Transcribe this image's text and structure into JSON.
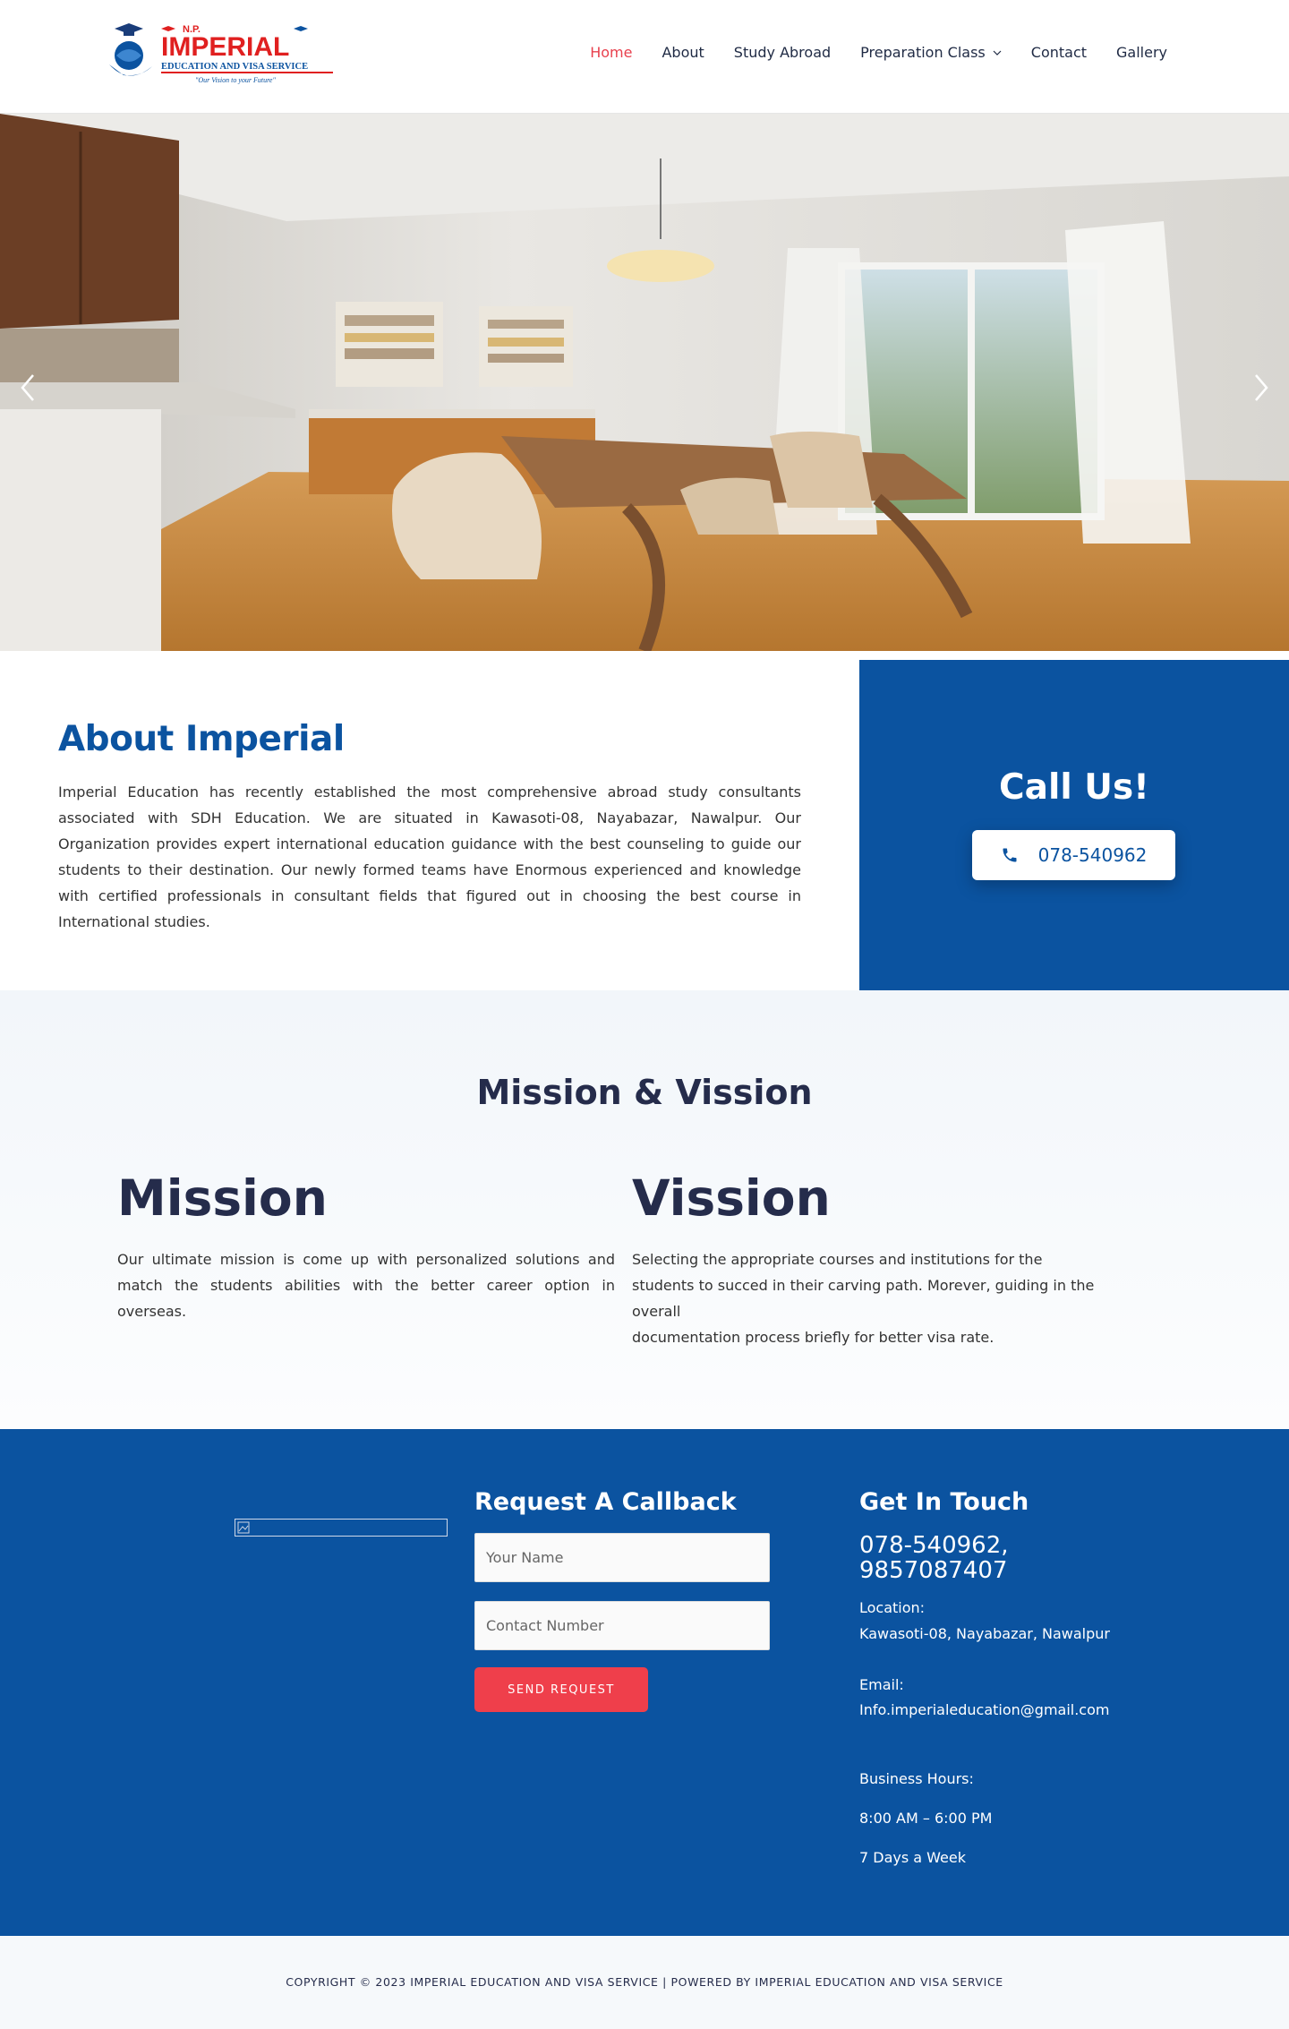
{
  "header": {
    "logo": {
      "top_text": "N.P.",
      "main_text": "IMPERIAL",
      "sub_text": "EDUCATION AND VISA SERVICE",
      "tagline": "\"Our Vision to your Future\""
    },
    "nav": [
      {
        "label": "Home",
        "active": true
      },
      {
        "label": "About"
      },
      {
        "label": "Study Abroad"
      },
      {
        "label": "Preparation Class",
        "has_dropdown": true
      },
      {
        "label": "Contact"
      },
      {
        "label": "Gallery"
      }
    ]
  },
  "hero": {
    "image": "dining-room-photo",
    "prev_icon": "chevron-left-icon",
    "next_icon": "chevron-right-icon"
  },
  "about": {
    "title": "About Imperial",
    "text": "Imperial Education has recently established the most comprehensive abroad study consultants associated with SDH Education. We are situated in Kawasoti-08, Nayabazar, Nawalpur. Our Organization provides expert international education guidance with the best counseling to guide our students to their destination. Our newly formed teams have Enormous experienced and knowledge with certified professionals in consultant fields that figured out in choosing the best course in International studies."
  },
  "call": {
    "title": "Call Us!",
    "phone": "078-540962",
    "icon": "phone-icon"
  },
  "mission_section": {
    "heading": "Mission & Vission",
    "mission": {
      "title": "Mission",
      "text": "Our ultimate mission is come up with personalized solutions and match the students abilities with the better career option in overseas."
    },
    "vision": {
      "title": "Vission",
      "line1": "Selecting the appropriate courses and institutions for the",
      "line2": "students to succed in their carving path. Morever, guiding in the overall",
      "line3": "documentation process briefly for better visa rate."
    }
  },
  "footer": {
    "callback": {
      "title": "Request A Callback",
      "name_placeholder": "Your Name",
      "phone_placeholder": "Contact Number",
      "button": "SEND REQUEST"
    },
    "contact": {
      "title": "Get In Touch",
      "phones_line1": "078-540962,",
      "phones_line2": "9857087407",
      "location_label": "Location:",
      "location": "Kawasoti-08, Nayabazar, Nawalpur",
      "email_label": "Email:",
      "email": "Info.imperialeducation@gmail.com",
      "hours_label": "Business Hours:",
      "hours": "8:00 AM – 6:00 PM",
      "days": "7 Days a Week"
    }
  },
  "copyright": "COPYRIGHT © 2023 IMPERIAL EDUCATION AND VISA SERVICE | POWERED BY IMPERIAL EDUCATION AND VISA SERVICE",
  "colors": {
    "brand_blue": "#0b53a0",
    "accent_red": "#ef3f4b",
    "nav_active": "#e8404d",
    "heading_dark": "#252c4b"
  }
}
